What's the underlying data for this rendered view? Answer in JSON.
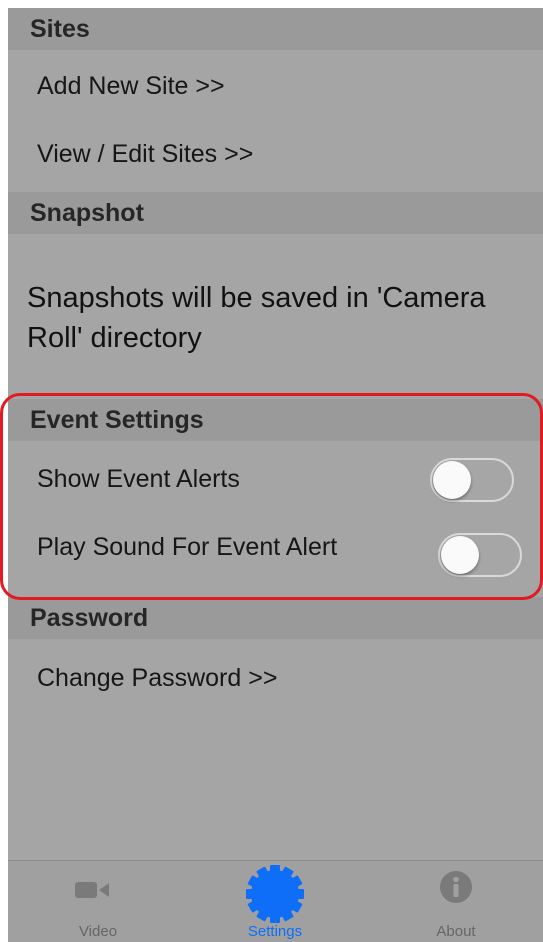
{
  "sections": {
    "sites": {
      "title": "Sites",
      "add_new_site": "Add New Site >>",
      "view_edit_sites": "View / Edit Sites >>"
    },
    "snapshot": {
      "title": "Snapshot",
      "info": "Snapshots will be saved in 'Camera Roll' directory"
    },
    "event_settings": {
      "title": "Event Settings",
      "show_event_alerts": {
        "label": "Show Event Alerts",
        "enabled": false
      },
      "play_sound": {
        "label": "Play Sound For Event Alert",
        "enabled": false
      }
    },
    "password": {
      "title": "Password",
      "change_password": "Change Password >>"
    }
  },
  "tabbar": {
    "tabs": [
      {
        "label": "Video",
        "icon": "video-camera-icon",
        "active": false
      },
      {
        "label": "Settings",
        "icon": "gear-icon",
        "active": true
      },
      {
        "label": "About",
        "icon": "info-icon",
        "active": false
      }
    ],
    "active_color": "#0f6ef7",
    "inactive_color": "#666666"
  },
  "colors": {
    "background": "#a5a5a5",
    "section_header": "#9a9a9a",
    "highlight_border": "#e21a22"
  }
}
